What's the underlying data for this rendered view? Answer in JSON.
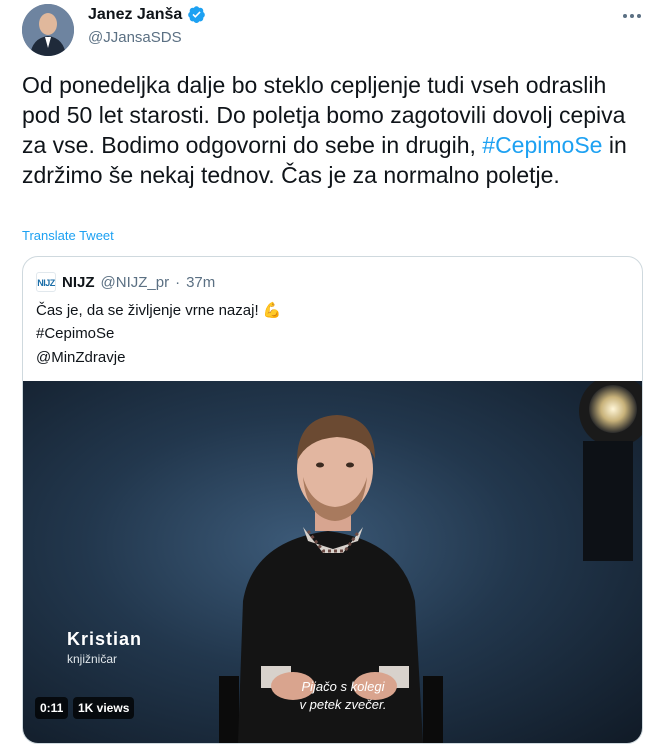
{
  "author": {
    "name": "Janez Janša",
    "handle": "@JJansaSDS"
  },
  "tweet": {
    "text_before": "Od ponedeljka dalje bo steklo cepljenje tudi vseh odraslih pod 50 let starosti. Do poletja bomo zagotovili dovolj cepiva za vse. Bodimo odgovorni do sebe in drugih, ",
    "hashtag": "#CepimoSe",
    "text_after": " in zdržimo še nekaj tednov. Čas je za normalno poletje.",
    "translate_label": "Translate Tweet"
  },
  "quote": {
    "logo_text": "NIJZ",
    "name": "NIJZ",
    "handle": "@NIJZ_pr",
    "separator": "·",
    "time": "37m",
    "line1": "Čas je, da se življenje vrne nazaj! 💪",
    "line2": "#CepimoSe",
    "line3": "@MinZdravje"
  },
  "video": {
    "caption_name": "Kristian",
    "caption_role": "knjižničar",
    "subtitle_line1": "Pijačo s kolegi",
    "subtitle_line2": "v petek zvečer.",
    "duration": "0:11",
    "views": "1K views"
  },
  "colors": {
    "link": "#1da1f2",
    "secondary_text": "#5b7083",
    "border": "#cfd9de"
  },
  "icons": {
    "verified": "verified-badge-icon",
    "more": "more-options-icon"
  }
}
